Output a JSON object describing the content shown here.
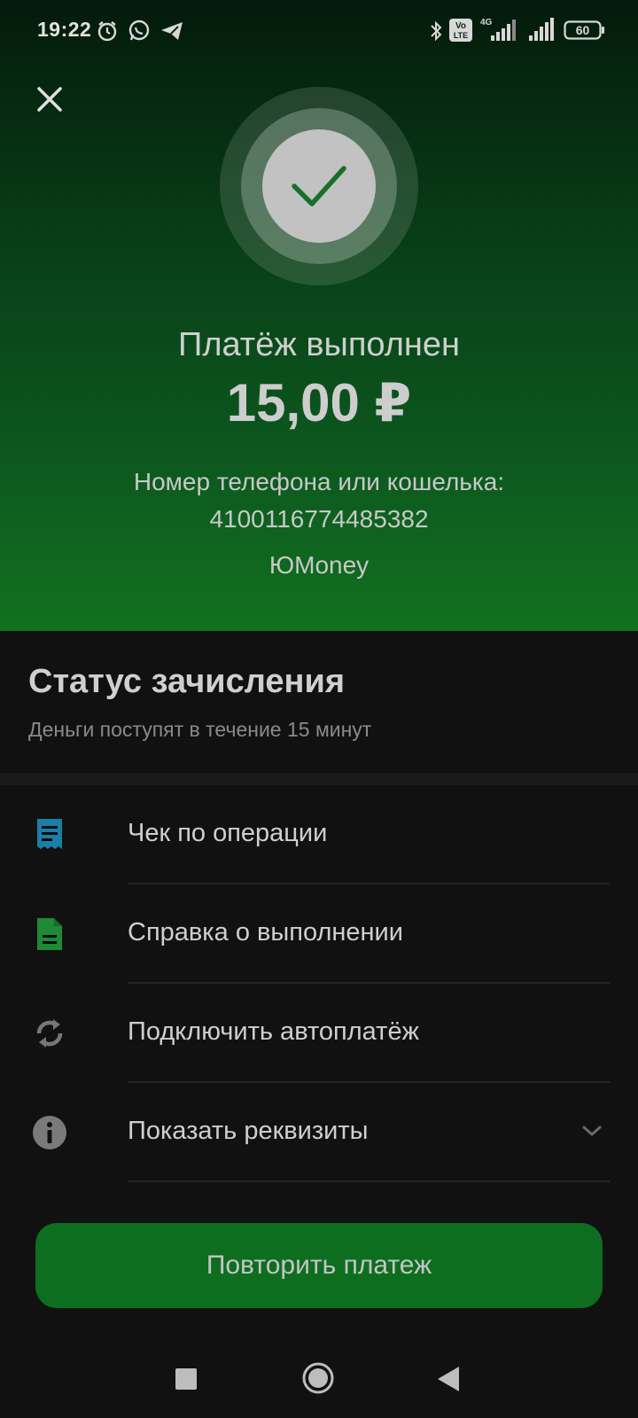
{
  "status_bar": {
    "time": "19:22",
    "icons": [
      "alarm-icon",
      "whatsapp-icon",
      "telegram-icon",
      "bluetooth-icon",
      "volte-icon",
      "signal-4g-icon",
      "signal-icon"
    ],
    "network": "4G",
    "volte": "Vo LTE",
    "battery": "60"
  },
  "hero": {
    "title": "Платёж выполнен",
    "amount": "15,00 ₽",
    "recipient_label": "Номер телефона или кошелька:",
    "recipient_number": "4100116774485382",
    "service": "ЮMoney"
  },
  "status": {
    "title": "Статус зачисления",
    "subtitle": "Деньги поступят в течение 15 минут"
  },
  "actions": [
    {
      "label": "Чек по операции",
      "icon": "receipt-icon"
    },
    {
      "label": "Справка о выполнении",
      "icon": "document-icon"
    },
    {
      "label": "Подключить автоплатёж",
      "icon": "autopay-icon"
    },
    {
      "label": "Показать реквизиты",
      "icon": "info-icon"
    }
  ],
  "repeat_button": {
    "label": "Повторить платеж"
  },
  "colors": {
    "accent_green": "#0d6e1f",
    "receipt_icon": "#1a7fa8",
    "document_icon": "#1f8a35",
    "background": "#111111"
  },
  "nav": [
    "recents-icon",
    "home-icon",
    "back-icon"
  ]
}
